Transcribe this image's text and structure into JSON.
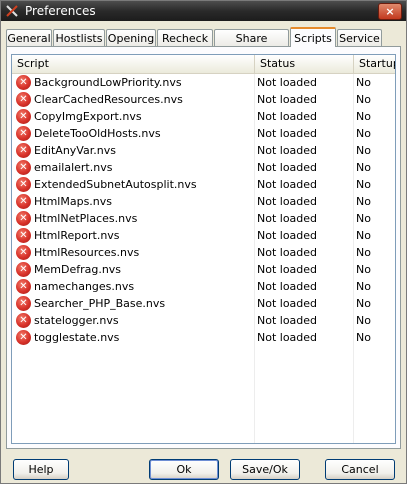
{
  "window": {
    "title": "Preferences",
    "close_label": "×"
  },
  "tabs": [
    {
      "label": "General"
    },
    {
      "label": "Hostlists"
    },
    {
      "label": "Opening"
    },
    {
      "label": "Recheck"
    },
    {
      "label": "Share images"
    },
    {
      "label": "Scripts",
      "active": true
    },
    {
      "label": "Service"
    }
  ],
  "list": {
    "columns": [
      "Script",
      "Status",
      "Startup"
    ],
    "rows": [
      {
        "script": "BackgroundLowPriority.nvs",
        "status": "Not loaded",
        "startup": "No"
      },
      {
        "script": "ClearCachedResources.nvs",
        "status": "Not loaded",
        "startup": "No"
      },
      {
        "script": "CopyImgExport.nvs",
        "status": "Not loaded",
        "startup": "No"
      },
      {
        "script": "DeleteTooOldHosts.nvs",
        "status": "Not loaded",
        "startup": "No"
      },
      {
        "script": "EditAnyVar.nvs",
        "status": "Not loaded",
        "startup": "No"
      },
      {
        "script": "emailalert.nvs",
        "status": "Not loaded",
        "startup": "No"
      },
      {
        "script": "ExtendedSubnetAutosplit.nvs",
        "status": "Not loaded",
        "startup": "No"
      },
      {
        "script": "HtmlMaps.nvs",
        "status": "Not loaded",
        "startup": "No"
      },
      {
        "script": "HtmlNetPlaces.nvs",
        "status": "Not loaded",
        "startup": "No"
      },
      {
        "script": "HtmlReport.nvs",
        "status": "Not loaded",
        "startup": "No"
      },
      {
        "script": "HtmlResources.nvs",
        "status": "Not loaded",
        "startup": "No"
      },
      {
        "script": "MemDefrag.nvs",
        "status": "Not loaded",
        "startup": "No"
      },
      {
        "script": "namechanges.nvs",
        "status": "Not loaded",
        "startup": "No"
      },
      {
        "script": "Searcher_PHP_Base.nvs",
        "status": "Not loaded",
        "startup": "No"
      },
      {
        "script": "statelogger.nvs",
        "status": "Not loaded",
        "startup": "No"
      },
      {
        "script": "togglestate.nvs",
        "status": "Not loaded",
        "startup": "No"
      }
    ],
    "row_icon": "error-x-icon"
  },
  "buttons": {
    "help": "Help",
    "ok": "Ok",
    "save_ok": "Save/Ok",
    "cancel": "Cancel"
  },
  "colors": {
    "titlebar": "#2a2a2a",
    "active_tab_accent": "#e68b2c",
    "error_icon": "#d8322a",
    "face": "#ece9d8"
  }
}
